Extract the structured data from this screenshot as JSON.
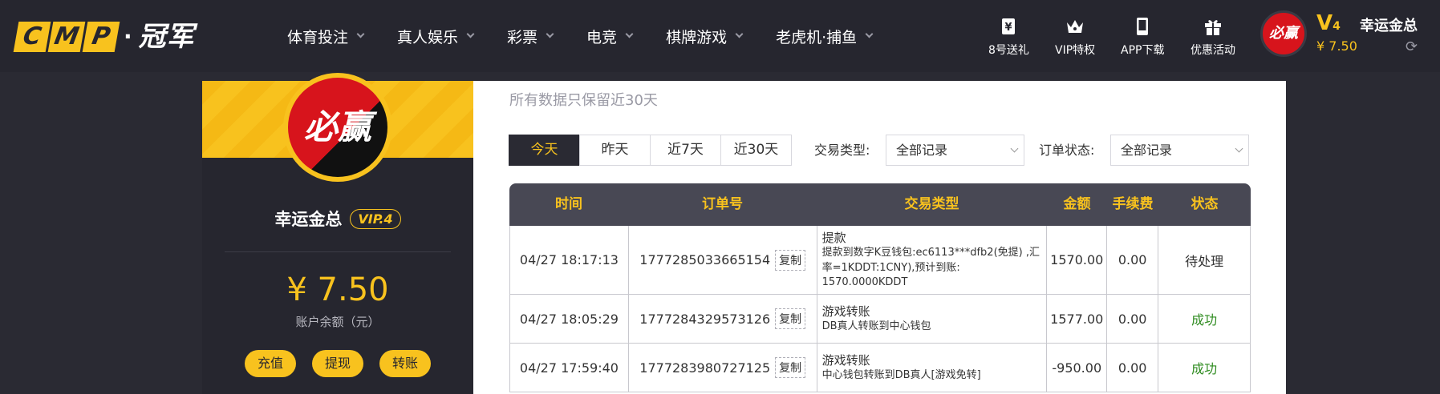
{
  "header": {
    "logo_left": "CMP",
    "logo_dot": "·",
    "logo_right": "冠军",
    "nav": [
      "体育投注",
      "真人娱乐",
      "彩票",
      "电竞",
      "棋牌游戏",
      "老虎机·捕鱼"
    ],
    "quick_links": [
      {
        "label": "8号送礼",
        "icon": "yen-icon"
      },
      {
        "label": "VIP特权",
        "icon": "crown-icon"
      },
      {
        "label": "APP下载",
        "icon": "phone-icon"
      },
      {
        "label": "优惠活动",
        "icon": "gift-icon"
      }
    ],
    "avatar_text": "必赢",
    "vip_level_letter": "V",
    "vip_level_num": "4",
    "balance": "¥ 7.50",
    "username": "幸运金总",
    "refresh_icon": "refresh-icon",
    "accent": "#f8c21e"
  },
  "profile": {
    "avatar_text": "必赢",
    "name": "幸运金总",
    "vip_badge": "VIP.4",
    "balance": "¥ 7.50",
    "balance_label": "账户余额（元）",
    "buttons": [
      "充值",
      "提现",
      "转账"
    ]
  },
  "records": {
    "note": "所有数据只保留近30天",
    "tabs": [
      "今天",
      "昨天",
      "近7天",
      "近30天"
    ],
    "active_tab": 0,
    "type_label": "交易类型:",
    "type_value": "全部记录",
    "status_label": "订单状态:",
    "status_value": "全部记录",
    "columns": [
      "时间",
      "订单号",
      "交易类型",
      "金额",
      "手续费",
      "状态"
    ],
    "copy_label": "复制",
    "rows": [
      {
        "time": "04/27 18:17:13",
        "order": "1777285033665154",
        "type": "提款",
        "detail": "提款到数字K豆钱包:ec6113***dfb2(免提) ,汇率=1KDDT:1CNY),预计到账: 1570.0000KDDT",
        "amount": "1570.00",
        "fee": "0.00",
        "status": "待处理",
        "status_color": "#333333"
      },
      {
        "time": "04/27 18:05:29",
        "order": "1777284329573126",
        "type": "游戏转账",
        "detail": "DB真人转账到中心钱包",
        "amount": "1577.00",
        "fee": "0.00",
        "status": "成功",
        "status_color": "#2e8b1f"
      },
      {
        "time": "04/27 17:59:40",
        "order": "1777283980727125",
        "type": "游戏转账",
        "detail": "中心钱包转账到DB真人[游戏免转]",
        "amount": "-950.00",
        "fee": "0.00",
        "status": "成功",
        "status_color": "#2e8b1f"
      }
    ]
  }
}
